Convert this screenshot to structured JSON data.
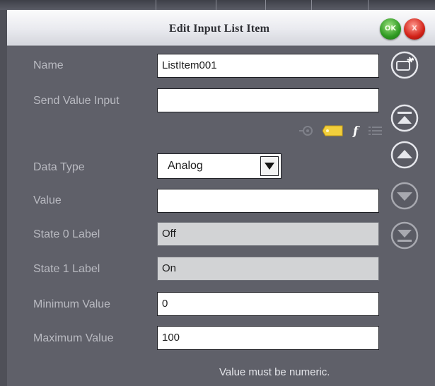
{
  "dialog": {
    "title": "Edit Input List Item",
    "ok_label": "OK",
    "cancel_label": "X"
  },
  "fields": {
    "name": {
      "label": "Name",
      "value": "ListItem001"
    },
    "send_value_input": {
      "label": "Send Value Input",
      "value": ""
    },
    "data_type": {
      "label": "Data Type",
      "value": "Analog"
    },
    "value": {
      "label": "Value",
      "value": ""
    },
    "state0": {
      "label": "State 0 Label",
      "value": "Off"
    },
    "state1": {
      "label": "State 1 Label",
      "value": "On"
    },
    "minimum": {
      "label": "Minimum Value",
      "value": "0"
    },
    "maximum": {
      "label": "Maximum Value",
      "value": "100"
    }
  },
  "insert_icons": [
    "signal-join-icon",
    "tag-icon",
    "function-icon",
    "list-icon"
  ],
  "side_buttons": [
    "add-item-icon",
    "move-top-icon",
    "move-up-icon",
    "move-down-icon",
    "move-bottom-icon"
  ],
  "status": {
    "message": "Value must be numeric."
  },
  "colors": {
    "dialog_bg": "#5f6069",
    "label_text": "#b9bac1",
    "ok_green": "#2f9a22",
    "cancel_red": "#d22218",
    "tag_yellow": "#f2cf3c"
  }
}
